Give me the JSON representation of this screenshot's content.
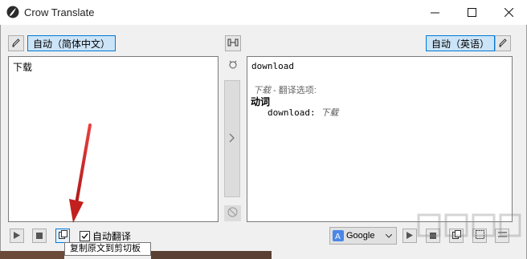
{
  "window": {
    "title": "Crow Translate"
  },
  "source": {
    "lang_label": "自动（简体中文）",
    "text": "下载"
  },
  "target": {
    "lang_label": "自动（英语）",
    "word": "download",
    "options_word": "下载",
    "options_label": " - 翻译选项:",
    "pos": "动词",
    "entry_term": "download:",
    "entry_translation": "下载"
  },
  "bottom": {
    "auto_translate_label": "自动翻译",
    "auto_translate_checked": true,
    "engine": "Google",
    "tooltip": "复制原文到剪切板"
  },
  "colors": {
    "accent": "#0078d7",
    "arrow": "#d42a2a"
  }
}
